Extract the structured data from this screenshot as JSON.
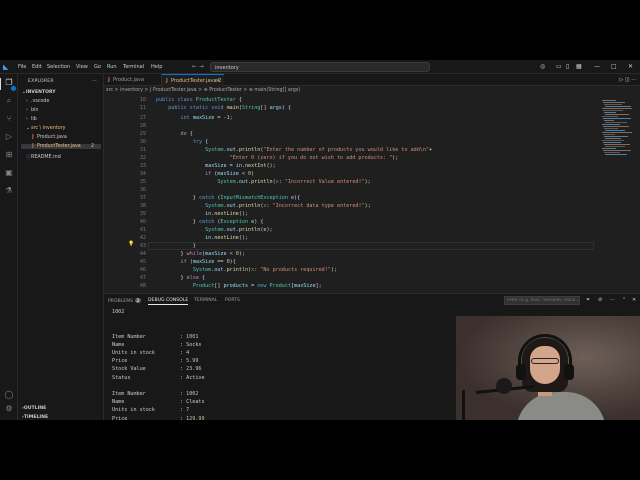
{
  "title_bar": {
    "menu": [
      "File",
      "Edit",
      "Selection",
      "View",
      "Go",
      "Run",
      "Terminal",
      "Help"
    ],
    "command_center": "inventory"
  },
  "sidebar": {
    "title": "EXPLORER",
    "workspace": "INVENTORY",
    "items": [
      {
        "label": ".vscode",
        "kind": "folder",
        "depth": 1
      },
      {
        "label": "bin",
        "kind": "folder",
        "depth": 1
      },
      {
        "label": "lib",
        "kind": "folder",
        "depth": 1
      },
      {
        "label": "src \\ inventory",
        "kind": "folder-open",
        "depth": 1
      },
      {
        "label": "Product.java",
        "kind": "java",
        "depth": 2
      },
      {
        "label": "ProductTester.java",
        "kind": "java",
        "depth": 2,
        "badge": "2"
      },
      {
        "label": "README.md",
        "kind": "md",
        "depth": 1
      }
    ],
    "outline": "OUTLINE",
    "timeline": "TIMELINE"
  },
  "editor": {
    "tabs": [
      {
        "label": "Product.java"
      },
      {
        "label": "ProductTester.java 2"
      }
    ],
    "breadcrumb": "src > inventory > J ProductTester.java > ⊛ ProductTester > ⊛ main(String[] args)",
    "sticky_lines": [
      {
        "num": "10",
        "text": "public class ProductTester {"
      },
      {
        "num": "11",
        "text": "    public static void main(String[] args) {"
      }
    ],
    "lines": [
      {
        "num": "27",
        "text": "        int maxSize = -1;"
      },
      {
        "num": "28",
        "text": ""
      },
      {
        "num": "29",
        "text": "        do {"
      },
      {
        "num": "30",
        "text": "            try {"
      },
      {
        "num": "31",
        "text": "                System.out.println(\"Enter the number of products you would like to add\\n\"+"
      },
      {
        "num": "32",
        "text": "                        \"Enter 0 (zero) if you do not wish to add products: \");"
      },
      {
        "num": "33",
        "text": "                maxSize = in.nextInt();"
      },
      {
        "num": "34",
        "text": "                if (maxSize < 0)"
      },
      {
        "num": "35",
        "text": "                    System.out.println(x: \"Incorrect Value entered!\");"
      },
      {
        "num": "36",
        "text": ""
      },
      {
        "num": "37",
        "text": "            } catch (InputMismatchException e){"
      },
      {
        "num": "38",
        "text": "                System.out.println(x: \"Incorrect data type entered!\");"
      },
      {
        "num": "39",
        "text": "                in.nextLine();"
      },
      {
        "num": "40",
        "text": "            } catch (Exception e) {"
      },
      {
        "num": "41",
        "text": "                System.out.println(e);"
      },
      {
        "num": "42",
        "text": "                in.nextLine();"
      },
      {
        "num": "43",
        "text": "            }"
      },
      {
        "num": "44",
        "text": "        } while(maxSize < 0);"
      },
      {
        "num": "45",
        "text": "        if (maxSize == 0){"
      },
      {
        "num": "46",
        "text": "            System.out.println(x: \"No products required!\");"
      },
      {
        "num": "47",
        "text": "        } else {"
      },
      {
        "num": "48",
        "text": "            Product[] products = new Product[maxSize];"
      }
    ]
  },
  "panel": {
    "tabs": [
      "PROBLEMS",
      "DEBUG CONSOLE",
      "TERMINAL",
      "PORTS"
    ],
    "problems_count": "2",
    "filter_placeholder": "Filter (e.g. text, !exclude, \\esca...",
    "console": [
      {
        "label": "1002",
        "value": ""
      },
      {
        "label": "",
        "value": ""
      },
      {
        "label": "",
        "value": ""
      },
      {
        "label": "Item Number",
        "value": ": 1001"
      },
      {
        "label": "Name",
        "value": ": Socks"
      },
      {
        "label": "Units in stock",
        "value": ": 4"
      },
      {
        "label": "Price",
        "value": ": 5.99"
      },
      {
        "label": "Stock Value",
        "value": ": 23.96"
      },
      {
        "label": "Status",
        "value": ": Active"
      },
      {
        "label": "",
        "value": ""
      },
      {
        "label": "Item Number",
        "value": ": 1002"
      },
      {
        "label": "Name",
        "value": ": Cleats"
      },
      {
        "label": "Units in stock",
        "value": ": 7"
      },
      {
        "label": "Price",
        "value": ": 129.99"
      }
    ]
  },
  "colors": {
    "accent": "#0078d4",
    "editor_bg": "#1f1f1f",
    "sidebar_bg": "#181818",
    "modified": "#e5c07b"
  }
}
